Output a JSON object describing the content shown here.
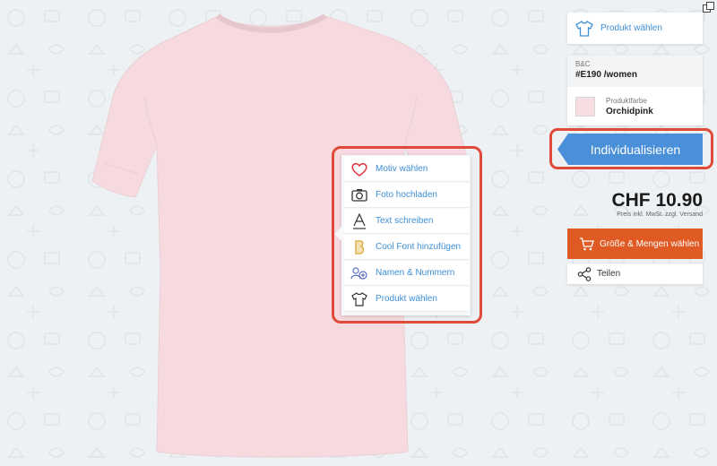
{
  "popup_menu": {
    "items": [
      {
        "label": "Motiv wählen",
        "icon": "heart-icon"
      },
      {
        "label": "Foto hochladen",
        "icon": "camera-icon"
      },
      {
        "label": "Text schreiben",
        "icon": "text-a-icon"
      },
      {
        "label": "Cool Font hinzufügen",
        "icon": "cool-font-icon"
      },
      {
        "label": "Namen & Nummern",
        "icon": "names-numbers-icon"
      },
      {
        "label": "Produkt wählen",
        "icon": "tshirt-icon"
      }
    ]
  },
  "sidebar": {
    "product_select": {
      "label": "Produkt wählen",
      "icon": "tshirt-icon"
    },
    "product_info": {
      "brand": "B&C",
      "model": "#E190 /women",
      "color_caption": "Produktfarbe",
      "color_name": "Orchidpink",
      "color_hex": "#f5dde1"
    },
    "customize_button": "Individualisieren",
    "price": "CHF 10.90",
    "price_note": "Preis inkl. MwSt. zzgl. Versand",
    "order_button": {
      "label": "Größe & Mengen wählen",
      "icon": "cart-icon"
    },
    "share": {
      "label": "Teilen",
      "icon": "share-icon"
    }
  },
  "colors": {
    "accent_blue": "#3d8fd6",
    "cta_blue": "#4a90d9",
    "order_orange": "#e05a23",
    "highlight_red": "#e04a3a",
    "shirt_pink": "#f5dde1"
  }
}
